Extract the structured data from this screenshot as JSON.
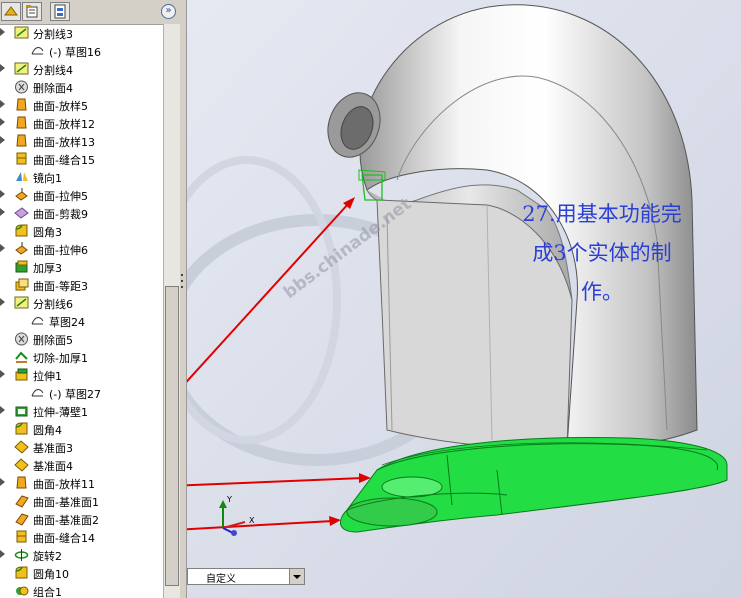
{
  "tree": {
    "items": [
      {
        "label": "分割线3",
        "icon": "split-line-icon",
        "expander": true,
        "indent": 0
      },
      {
        "label": "(-) 草图16",
        "icon": "sketch-icon",
        "expander": false,
        "indent": 1
      },
      {
        "label": "分割线4",
        "icon": "split-line-icon",
        "expander": true,
        "indent": 0
      },
      {
        "label": "删除面4",
        "icon": "delete-face-icon",
        "expander": false,
        "indent": 0
      },
      {
        "label": "曲面-放样5",
        "icon": "surface-loft-icon",
        "expander": true,
        "indent": 0
      },
      {
        "label": "曲面-放样12",
        "icon": "surface-loft-icon",
        "expander": true,
        "indent": 0
      },
      {
        "label": "曲面-放样13",
        "icon": "surface-loft-icon",
        "expander": true,
        "indent": 0
      },
      {
        "label": "曲面-缝合15",
        "icon": "surface-knit-icon",
        "expander": false,
        "indent": 0
      },
      {
        "label": "镜向1",
        "icon": "mirror-icon",
        "expander": false,
        "indent": 0
      },
      {
        "label": "曲面-拉伸5",
        "icon": "surface-extrude-icon",
        "expander": true,
        "indent": 0
      },
      {
        "label": "曲面-剪裁9",
        "icon": "surface-trim-icon",
        "expander": true,
        "indent": 0
      },
      {
        "label": "圆角3",
        "icon": "fillet-icon",
        "expander": false,
        "indent": 0
      },
      {
        "label": "曲面-拉伸6",
        "icon": "surface-extrude-icon",
        "expander": true,
        "indent": 0
      },
      {
        "label": "加厚3",
        "icon": "thicken-icon",
        "expander": false,
        "indent": 0
      },
      {
        "label": "曲面-等距3",
        "icon": "surface-offset-icon",
        "expander": false,
        "indent": 0
      },
      {
        "label": "分割线6",
        "icon": "split-line-icon",
        "expander": true,
        "indent": 0
      },
      {
        "label": "草图24",
        "icon": "sketch-icon",
        "expander": false,
        "indent": 1
      },
      {
        "label": "删除面5",
        "icon": "delete-face-icon",
        "expander": false,
        "indent": 0
      },
      {
        "label": "切除-加厚1",
        "icon": "cut-thicken-icon",
        "expander": false,
        "indent": 0
      },
      {
        "label": "拉伸1",
        "icon": "extrude-icon",
        "expander": true,
        "indent": 0
      },
      {
        "label": "(-) 草图27",
        "icon": "sketch-icon",
        "expander": false,
        "indent": 1
      },
      {
        "label": "拉伸-薄壁1",
        "icon": "extrude-thin-icon",
        "expander": true,
        "indent": 0
      },
      {
        "label": "圆角4",
        "icon": "fillet-icon",
        "expander": false,
        "indent": 0
      },
      {
        "label": "基准面3",
        "icon": "plane-icon",
        "expander": false,
        "indent": 0
      },
      {
        "label": "基准面4",
        "icon": "plane-icon",
        "expander": false,
        "indent": 0
      },
      {
        "label": "曲面-放样11",
        "icon": "surface-loft-icon",
        "expander": true,
        "indent": 0
      },
      {
        "label": "曲面-基准面1",
        "icon": "surface-plane-icon",
        "expander": false,
        "indent": 0
      },
      {
        "label": "曲面-基准面2",
        "icon": "surface-plane-icon",
        "expander": false,
        "indent": 0
      },
      {
        "label": "曲面-缝合14",
        "icon": "surface-knit-icon",
        "expander": false,
        "indent": 0
      },
      {
        "label": "旋转2",
        "icon": "revolve-icon",
        "expander": true,
        "indent": 0
      },
      {
        "label": "圆角10",
        "icon": "fillet-icon",
        "expander": false,
        "indent": 0
      },
      {
        "label": "组合1",
        "icon": "combine-icon",
        "expander": false,
        "indent": 0
      }
    ]
  },
  "collapse_glyph": "»",
  "view_select": {
    "value": "自定义"
  },
  "annotation": {
    "lines": [
      "27.用基本功能完",
      "成3个实体的制",
      "作。"
    ]
  },
  "watermark": "bbs.chinade.net",
  "triad": {
    "x_label": "X",
    "y_label": "Y"
  },
  "colors": {
    "annotation": "#2a3fd6",
    "arrow": "#e00000",
    "solid_green": "#22dd44",
    "tree_icon_yellow": "#f0c020"
  }
}
